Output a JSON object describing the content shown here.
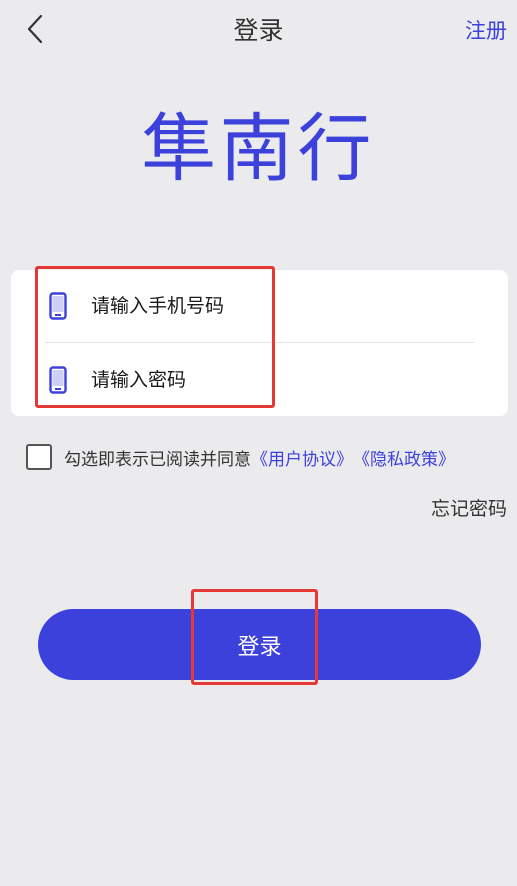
{
  "header": {
    "title": "登录",
    "register_label": "注册",
    "back_icon": "chevron-left-icon"
  },
  "brand": {
    "name": "隼南行"
  },
  "form": {
    "phone": {
      "placeholder": "请输入手机号码",
      "value": "",
      "icon": "phone-icon"
    },
    "password": {
      "placeholder": "请输入密码",
      "value": "",
      "icon": "phone-icon"
    }
  },
  "agreement": {
    "checked": false,
    "text": "勾选即表示已阅读并同意",
    "user_agreement": "《用户协议》",
    "privacy_policy": "《隐私政策》"
  },
  "forgot_password_label": "忘记密码",
  "login_button_label": "登录",
  "colors": {
    "accent": "#3d41dc",
    "background": "#ebebed",
    "highlight": "#e53935"
  }
}
